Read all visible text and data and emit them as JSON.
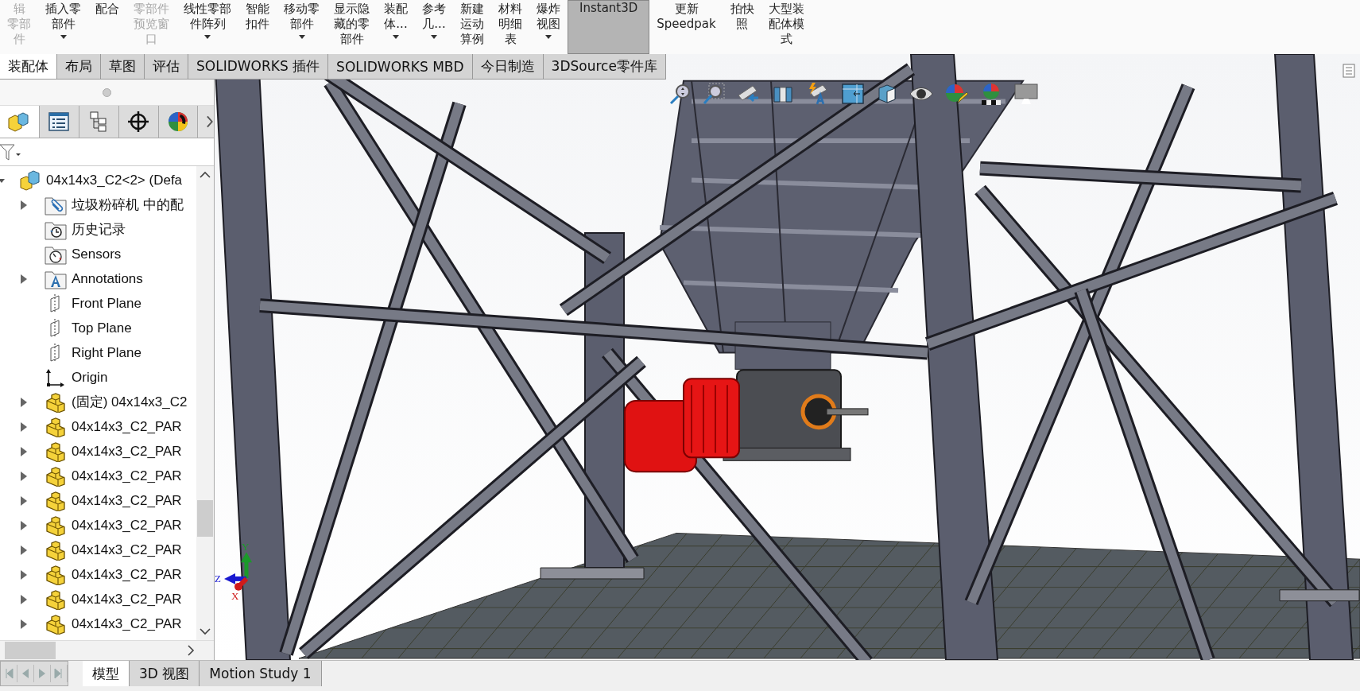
{
  "ribbon": [
    {
      "lines": [
        "辑",
        "零部",
        "件"
      ],
      "disabled": true,
      "dropdown": false,
      "selected": false
    },
    {
      "lines": [
        "插入零",
        "部件"
      ],
      "disabled": false,
      "dropdown": true,
      "selected": false
    },
    {
      "lines": [
        "配合"
      ],
      "disabled": false,
      "dropdown": false,
      "selected": false
    },
    {
      "lines": [
        "零部件",
        "预览窗",
        "口"
      ],
      "disabled": true,
      "dropdown": false,
      "selected": false
    },
    {
      "lines": [
        "线性零部",
        "件阵列"
      ],
      "disabled": false,
      "dropdown": true,
      "selected": false
    },
    {
      "lines": [
        "智能",
        "扣件"
      ],
      "disabled": false,
      "dropdown": false,
      "selected": false
    },
    {
      "lines": [
        "移动零",
        "部件"
      ],
      "disabled": false,
      "dropdown": true,
      "selected": false
    },
    {
      "lines": [
        "显示隐",
        "藏的零",
        "部件"
      ],
      "disabled": false,
      "dropdown": false,
      "selected": false
    },
    {
      "lines": [
        "装配",
        "体..."
      ],
      "disabled": false,
      "dropdown": true,
      "selected": false
    },
    {
      "lines": [
        "参考",
        "几..."
      ],
      "disabled": false,
      "dropdown": true,
      "selected": false
    },
    {
      "lines": [
        "新建",
        "运动",
        "算例"
      ],
      "disabled": false,
      "dropdown": false,
      "selected": false
    },
    {
      "lines": [
        "材料",
        "明细",
        "表"
      ],
      "disabled": false,
      "dropdown": false,
      "selected": false
    },
    {
      "lines": [
        "爆炸",
        "视图"
      ],
      "disabled": false,
      "dropdown": true,
      "selected": false
    },
    {
      "lines": [
        "Instant3D"
      ],
      "disabled": false,
      "dropdown": false,
      "selected": true
    },
    {
      "lines": [
        "更新",
        "Speedpak"
      ],
      "disabled": false,
      "dropdown": false,
      "selected": false
    },
    {
      "lines": [
        "拍快",
        "照"
      ],
      "disabled": false,
      "dropdown": false,
      "selected": false
    },
    {
      "lines": [
        "大型装",
        "配体模",
        "式"
      ],
      "disabled": false,
      "dropdown": false,
      "selected": false
    }
  ],
  "tabs": [
    {
      "label": "装配体",
      "selected": true
    },
    {
      "label": "布局",
      "selected": false
    },
    {
      "label": "草图",
      "selected": false
    },
    {
      "label": "评估",
      "selected": false
    },
    {
      "label": "SOLIDWORKS 插件",
      "selected": false
    },
    {
      "label": "SOLIDWORKS MBD",
      "selected": false
    },
    {
      "label": "今日制造",
      "selected": false
    },
    {
      "label": "3DSource零件库",
      "selected": false
    }
  ],
  "panel_tabs": [
    {
      "kind": "features",
      "selected": true
    },
    {
      "kind": "properties",
      "selected": false
    },
    {
      "kind": "configurations",
      "selected": false
    },
    {
      "kind": "dimxpert",
      "selected": false
    },
    {
      "kind": "display",
      "selected": false
    }
  ],
  "tree": {
    "label": "04x14x3_C2<2> (Defa",
    "expanded": true,
    "children": [
      {
        "kind": "mates",
        "label": "垃圾粉碎机 中的配",
        "expandable": true
      },
      {
        "kind": "history",
        "label": "历史记录",
        "expandable": false
      },
      {
        "kind": "sensors",
        "label": "Sensors",
        "expandable": false
      },
      {
        "kind": "annotations",
        "label": "Annotations",
        "expandable": true
      },
      {
        "kind": "plane",
        "label": "Front Plane",
        "expandable": false
      },
      {
        "kind": "plane",
        "label": "Top Plane",
        "expandable": false
      },
      {
        "kind": "plane",
        "label": "Right Plane",
        "expandable": false
      },
      {
        "kind": "origin",
        "label": "Origin",
        "expandable": false
      },
      {
        "kind": "part",
        "label": "(固定) 04x14x3_C2",
        "expandable": true
      },
      {
        "kind": "part",
        "label": "04x14x3_C2_PAR",
        "expandable": true
      },
      {
        "kind": "part",
        "label": "04x14x3_C2_PAR",
        "expandable": true
      },
      {
        "kind": "part",
        "label": "04x14x3_C2_PAR",
        "expandable": true
      },
      {
        "kind": "part",
        "label": "04x14x3_C2_PAR",
        "expandable": true
      },
      {
        "kind": "part",
        "label": "04x14x3_C2_PAR",
        "expandable": true
      },
      {
        "kind": "part",
        "label": "04x14x3_C2_PAR",
        "expandable": true
      },
      {
        "kind": "part",
        "label": "04x14x3_C2_PAR",
        "expandable": true
      },
      {
        "kind": "part",
        "label": "04x14x3_C2_PAR",
        "expandable": true
      },
      {
        "kind": "part",
        "label": "04x14x3_C2_PAR",
        "expandable": true
      }
    ]
  },
  "triad": {
    "x": "X",
    "y": "Y",
    "z": "Z"
  },
  "bottom_tabs": [
    {
      "label": "模型",
      "selected": true
    },
    {
      "label": "3D 视图",
      "selected": false
    },
    {
      "label": "Motion Study 1",
      "selected": false
    }
  ]
}
